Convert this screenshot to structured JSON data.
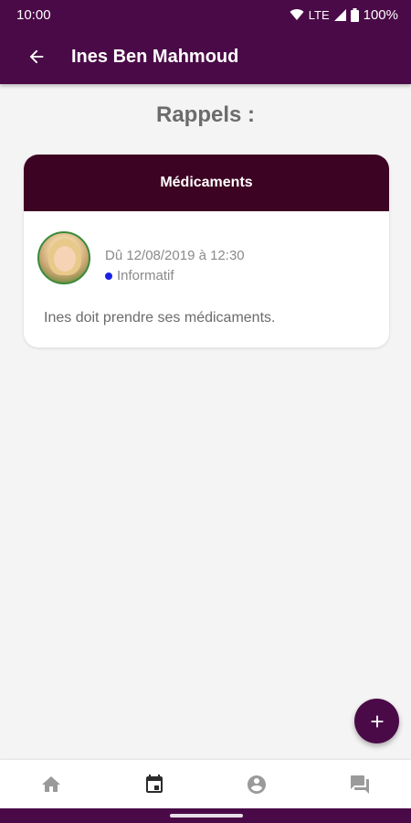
{
  "status_bar": {
    "time": "10:00",
    "network": "LTE",
    "battery": "100%"
  },
  "app_bar": {
    "title": "Ines Ben Mahmoud"
  },
  "section": {
    "title": "Rappels :"
  },
  "card": {
    "header": "Médicaments",
    "date": "Dû 12/08/2019 à 12:30",
    "type": "Informatif",
    "type_color": "#1a22e6",
    "message": "Ines doit prendre ses médicaments."
  },
  "bottom_nav": {
    "items": [
      "home-icon",
      "calendar-icon",
      "account-icon",
      "messages-icon"
    ],
    "active": "calendar-icon"
  },
  "colors": {
    "primary": "#4a0a47",
    "card_header": "#3d0322",
    "background": "#f4f4f4"
  }
}
